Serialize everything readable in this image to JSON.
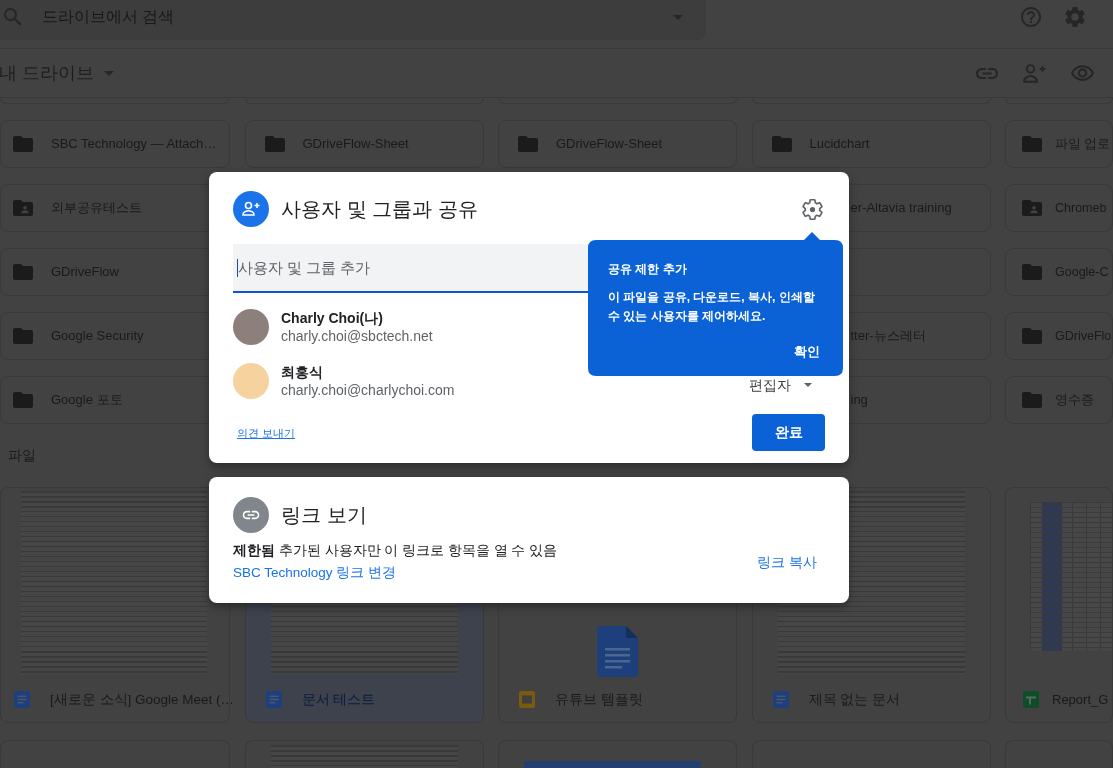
{
  "search_bar": {
    "placeholder": "드라이브에서 검색"
  },
  "drive_header": {
    "title": "내 드라이브"
  },
  "folder_rows": [
    [
      {
        "name": "SBC Technology — Attach…",
        "kind": "folder"
      },
      {
        "name": "GDriveFlow-Sheet",
        "kind": "folder"
      },
      {
        "name": "GDriveFlow-Sheet",
        "kind": "folder"
      },
      {
        "name": "Lucidchart",
        "kind": "folder"
      },
      {
        "name": "파일 업로",
        "kind": "folder"
      }
    ],
    [
      {
        "name": "외부공유테스트",
        "kind": "shared_folder"
      },
      {
        "name": "er-Altavia training",
        "kind": "partial"
      },
      {
        "name": "Chromeb",
        "kind": "shared_folder"
      }
    ],
    [
      {
        "name": "GDriveFlow",
        "kind": "folder"
      },
      {
        "kind": "partial"
      },
      {
        "name": "Google-C",
        "kind": "folder"
      }
    ],
    [
      {
        "name": "Google Security",
        "kind": "folder"
      },
      {
        "name": "tter-뉴스레터",
        "kind": "partial"
      },
      {
        "name": "GDriveFlo",
        "kind": "folder"
      }
    ],
    [
      {
        "name": "Google 포토",
        "kind": "folder"
      },
      {
        "name": "ing",
        "kind": "partial"
      },
      {
        "name": "영수증",
        "kind": "folder"
      }
    ]
  ],
  "files_heading": "파일",
  "files": [
    {
      "name": "[새로운 소식] Google Meet (…",
      "kind": "document",
      "preview": {
        "kind": "page"
      },
      "selected": false
    },
    {
      "name": "문서 테스트",
      "kind": "document",
      "preview": {
        "kind": "page"
      },
      "selected": true
    },
    {
      "name": "유튜브 템플릿",
      "kind": "slides",
      "preview": {
        "kind": "icon"
      },
      "selected": false
    },
    {
      "name": "제목 없는 문서",
      "kind": "document",
      "preview": {
        "kind": "page"
      },
      "selected": false
    },
    {
      "name": "Report_G",
      "kind": "spreadsheet",
      "preview": {
        "kind": "sheet"
      },
      "selected": false
    }
  ],
  "more_files": [
    {
      "kind": "blank"
    },
    {
      "kind": "page"
    },
    {
      "kind": "heading"
    },
    {
      "kind": "blank"
    },
    {
      "kind": "blank"
    }
  ],
  "share_dialog": {
    "title": "사용자 및 그룹과 공유",
    "add_field": {
      "placeholder": "사용자 및 그룹 추가"
    },
    "people": [
      {
        "name": "Charly Choi(나)",
        "email": "charly.choi@sbctech.net"
      },
      {
        "name": "최홍식",
        "email": "charly.choi@charlychoi.com",
        "role": "편집자"
      }
    ],
    "feedback_link": "의견 보내기",
    "done_button": "완료",
    "tip": {
      "title": "공유 제한 추가",
      "text": "이 파일을 공유, 다운로드, 복사, 인쇄할 수 있는 사용자를 제어하세요.",
      "button": "확인"
    }
  },
  "link_dialog": {
    "title": "링크 보기",
    "access": "**제한됨** 추가된 사용자만 이 링크로 항목을 열 수 있음",
    "change_link": "SBC Technology 링크 변경",
    "copy_button": "링크 복사"
  }
}
